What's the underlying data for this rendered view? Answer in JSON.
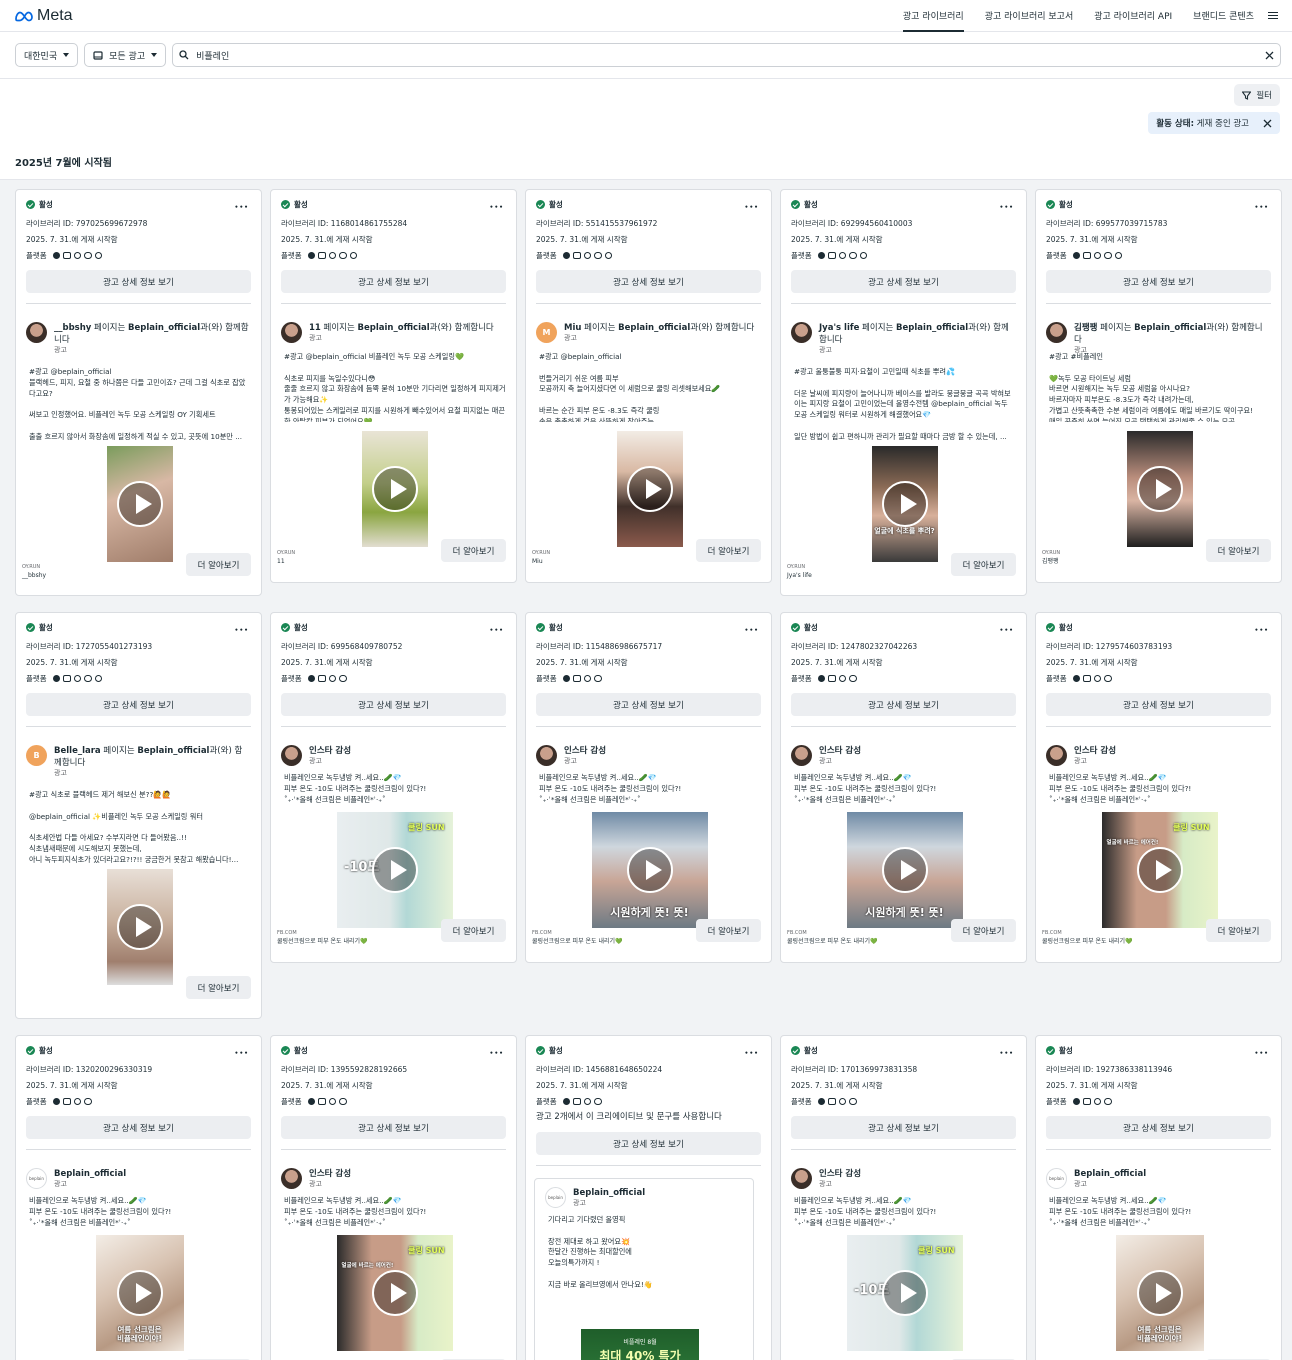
{
  "brand": "Meta",
  "nav": [
    "광고 라이브러리",
    "광고 라이브러리 보고서",
    "광고 라이브러리 API",
    "브랜디드 콘텐츠"
  ],
  "search": {
    "country": "대한민국",
    "adtype": "모든 광고",
    "query": "비플레인"
  },
  "filter_label": "필터",
  "chip": {
    "key": "활동 상태:",
    "value": "게재 중인 광고"
  },
  "section_title": "2025년 7월에 시작됨",
  "labels": {
    "active": "활성",
    "lib_prefix": "라이브러리 ID: ",
    "platform": "플랫폼",
    "detail": "광고 상세 정보 보기",
    "learn": "더 알아보기",
    "sponsored": "광고",
    "with_suffix": "과(와) 함께합니다",
    "page_mid": " 페이지는 "
  },
  "cards": [
    {
      "id": "797025699672978",
      "date": "2025. 7. 31.에 게재 시작함",
      "page": "__bbshy",
      "partner": "Beplain_official",
      "text": "#광고 @beplain_official\n블랙헤드, 피지, 요철 중 하나쯤은 다들 고민이죠? 근데 그걸 식초로 잡았다고요?\n\n써보고 인정했어요. 비플레인 녹두 모공 스케일링 OY 기획세트\n\n출출 흐르지 않아서 화장솜에 일정하게 적실 수 있고, 곳뜻에 10분만 ...",
      "dom": "OY.RUN",
      "foot": "__bbshy"
    },
    {
      "id": "1168014861755284",
      "date": "2025. 7. 31.에 게재 시작함",
      "page": "11",
      "partner": "Beplain_official",
      "text": "#광고 @beplain_official 비플레인 녹두 모공 스케일링💚\n\n식초로 피지를 녹일수있다니😳\n줄줄 흐르지 않고 화장솜에 듬뿍 묻혀 10분만 기다리면 일정하게 피지제거가 가능해요✨\n통봉되어있는 스케일러로 피지를 시원하게 빼수있어서 요철 피지없는 매끈한 안탈칼 피부가 되었어요💚...",
      "dom": "OY.RUN",
      "foot": "11"
    },
    {
      "id": "551415537961972",
      "date": "2025. 7. 31.에 게재 시작함",
      "page": "Miu",
      "partner": "Beplain_official",
      "text": "#광고 @beplain_official\n\n번들거리기 쉬운 여름 피부\n모공까지 축 늘어지셨다면 이 세럼으로 쿨링 리셋해보세요🥒\n\n바르는 순간 피부 온도 -8.3도 즉각 쿨링\n속은 촉촉하게 겉은 산뜻하게 잡아주는...",
      "dom": "OY.RUN",
      "foot": "Miu"
    },
    {
      "id": "692994560410003",
      "date": "2025. 7. 31.에 게재 시작함",
      "page": "Jya's life",
      "partner": "Beplain_official",
      "text": "#광고 울퉁불퉁 피지·요철이 고민일때 식초를 뿌려💦\n\n더운 날씨에 피지량이 늘어나니까 베이스를 발라도 뭉글뭉글 곡곡 박혀보이는 피지랑 요철이 고민이었는데 올영수전템 @beplain_official 녹두 모공 스케일링 워터로 시원하게 해결했어요💎\n\n일단 방법이 쉽고 편하니까 관리가 필요할 때마다 금방 할 수 있는데, ...",
      "dom": "OY.RUN",
      "foot": "Jya's life"
    },
    {
      "id": "699577039715783",
      "date": "2025. 7. 31.에 게재 시작함",
      "page": "김팽팽",
      "partner": "Beplain_official",
      "text": "#광고 #비플레인\n\n💚녹두 모공 타이트닝 세럼\n바르면 시원해지는 녹두 모공 세럼을 아시나요?\n바르자마자 피부온도 -8.3도가 즉각 내려가는데,\n가볍고 산뜻촉촉한 수분 세럼이라 여름에도 매일 바르기도 딱이구요!\n매일 꾸준히 쓰면 늘어진 모공 탱탱하게 관리해줄 수 있는 모공 ...",
      "dom": "OY.RUN",
      "foot": "김팽팽"
    },
    {
      "id": "1727055401273193",
      "date": "2025. 7. 31.에 게재 시작함",
      "page": "Belle_lara",
      "partner": "Beplain_official",
      "text": "#광고 식초로 블랙헤드 제거 해보신 분??🙋🙋\n\n@beplain_official ✨비플레인 녹두 모공 스케일링 워터\n\n식초세안법 다들 아세요? 수부지라면 다 들어봤음..!!\n식초냄새때문에 시도해보지 못했는데,\n아니 녹두피지식초가 있더라고요?!?!! 궁금한거 못참고 해봤습니다!..."
    },
    {
      "id": "699568409780752",
      "date": "2025. 7. 31.에 게재 시작함",
      "page": "인스타 감성",
      "text": "비플레인으로 녹두냉방 켜..세요..🥒💎\n피부 온도 -10도 내려주는 쿨링선크림이 있다?!\n˚₊·ʾ*올해 선크림은 비플레인*ʾ·₊˚",
      "dom": "FB.COM",
      "foot": "쿨링선크림으로 피부 온도 내리기💚"
    },
    {
      "id": "1154886986675717",
      "date": "2025. 7. 31.에 게재 시작함",
      "page": "인스타 감성",
      "text": "비플레인으로 녹두냉방 켜..세요..🥒💎\n피부 온도 -10도 내려주는 쿨링선크림이 있다?!\n˚₊·ʾ*올해 선크림은 비플레인*ʾ·₊˚",
      "dom": "FB.COM",
      "foot": "쿨링선크림으로 피부 온도 내리기💚"
    },
    {
      "id": "1247802327042263",
      "date": "2025. 7. 31.에 게재 시작함",
      "page": "인스타 감성",
      "text": "비플레인으로 녹두냉방 켜..세요..🥒💎\n피부 온도 -10도 내려주는 쿨링선크림이 있다?!\n˚₊·ʾ*올해 선크림은 비플레인*ʾ·₊˚",
      "dom": "FB.COM",
      "foot": "쿨링선크림으로 피부 온도 내리기💚"
    },
    {
      "id": "1279574603783193",
      "date": "2025. 7. 31.에 게재 시작함",
      "page": "인스타 감성",
      "text": "비플레인으로 녹두냉방 켜..세요..🥒💎\n피부 온도 -10도 내려주는 쿨링선크림이 있다?!\n˚₊·ʾ*올해 선크림은 비플레인*ʾ·₊˚",
      "dom": "FB.COM",
      "foot": "쿨링선크림으로 피부 온도 내리기💚"
    },
    {
      "id": "1320200296330319",
      "date": "2025. 7. 31.에 게재 시작함",
      "page": "Beplain_official",
      "text": "비플레인으로 녹두냉방 켜..세요..🥒💎\n피부 온도 -10도 내려주는 쿨링선크림이 있다?!\n˚₊·ʾ*올해 선크림은 비플레인*ʾ·₊˚"
    },
    {
      "id": "1395592828192665",
      "date": "2025. 7. 31.에 게재 시작함",
      "page": "인스타 감성",
      "text": "비플레인으로 녹두냉방 켜..세요..🥒💎\n피부 온도 -10도 내려주는 쿨링선크림이 있다?!\n˚₊·ʾ*올해 선크림은 비플레인*ʾ·₊˚"
    },
    {
      "id": "1456881648650224",
      "date": "2025. 7. 31.에 게재 시작함",
      "multi": "광고 2개에서 이 크리에이티브 및 문구를 사용합니다",
      "page": "Beplain_official",
      "text": "기다리고 기다렸던 올영픽\n\n장전 제대로 하고 왔어요💥\n한달간 진행하는 최대할인에\n오늘의특가까지 !\n\n지금 바로 올리브영에서 만나요!👋"
    },
    {
      "id": "1701369973831358",
      "date": "2025. 7. 31.에 게재 시작함",
      "page": "인스타 감성",
      "text": "비플레인으로 녹두냉방 켜..세요..🥒💎\n피부 온도 -10도 내려주는 쿨링선크림이 있다?!\n˚₊·ʾ*올해 선크림은 비플레인*ʾ·₊˚"
    },
    {
      "id": "1927386338113946",
      "date": "2025. 7. 31.에 게재 시작함",
      "page": "Beplain_official",
      "text": "비플레인으로 녹두냉방 켜..세요..🥒💎\n피부 온도 -10도 내려주는 쿨링선크림이 있다?!\n˚₊·ʾ*올해 선크림은 비플레인*ʾ·₊˚"
    }
  ],
  "overlays": {
    "c3": "얼굴에 식초를 뿌려?",
    "c7a": "시원하게 뜻! 뜻!",
    "c9a": "얼굴에 바르는 에어컨!",
    "c9b": "쿨링 SUN",
    "c6b": "쿨링 SUN",
    "c6a": "-10도",
    "c10": "여름 선크림은\n비플레인이야!",
    "c12a": "비플레인 8월",
    "c12b": "최대 40% 특가"
  },
  "colors": {
    "active": "#1a8754",
    "nav_ink": "#1c2b33",
    "chip_bg": "#e7f0fb"
  }
}
